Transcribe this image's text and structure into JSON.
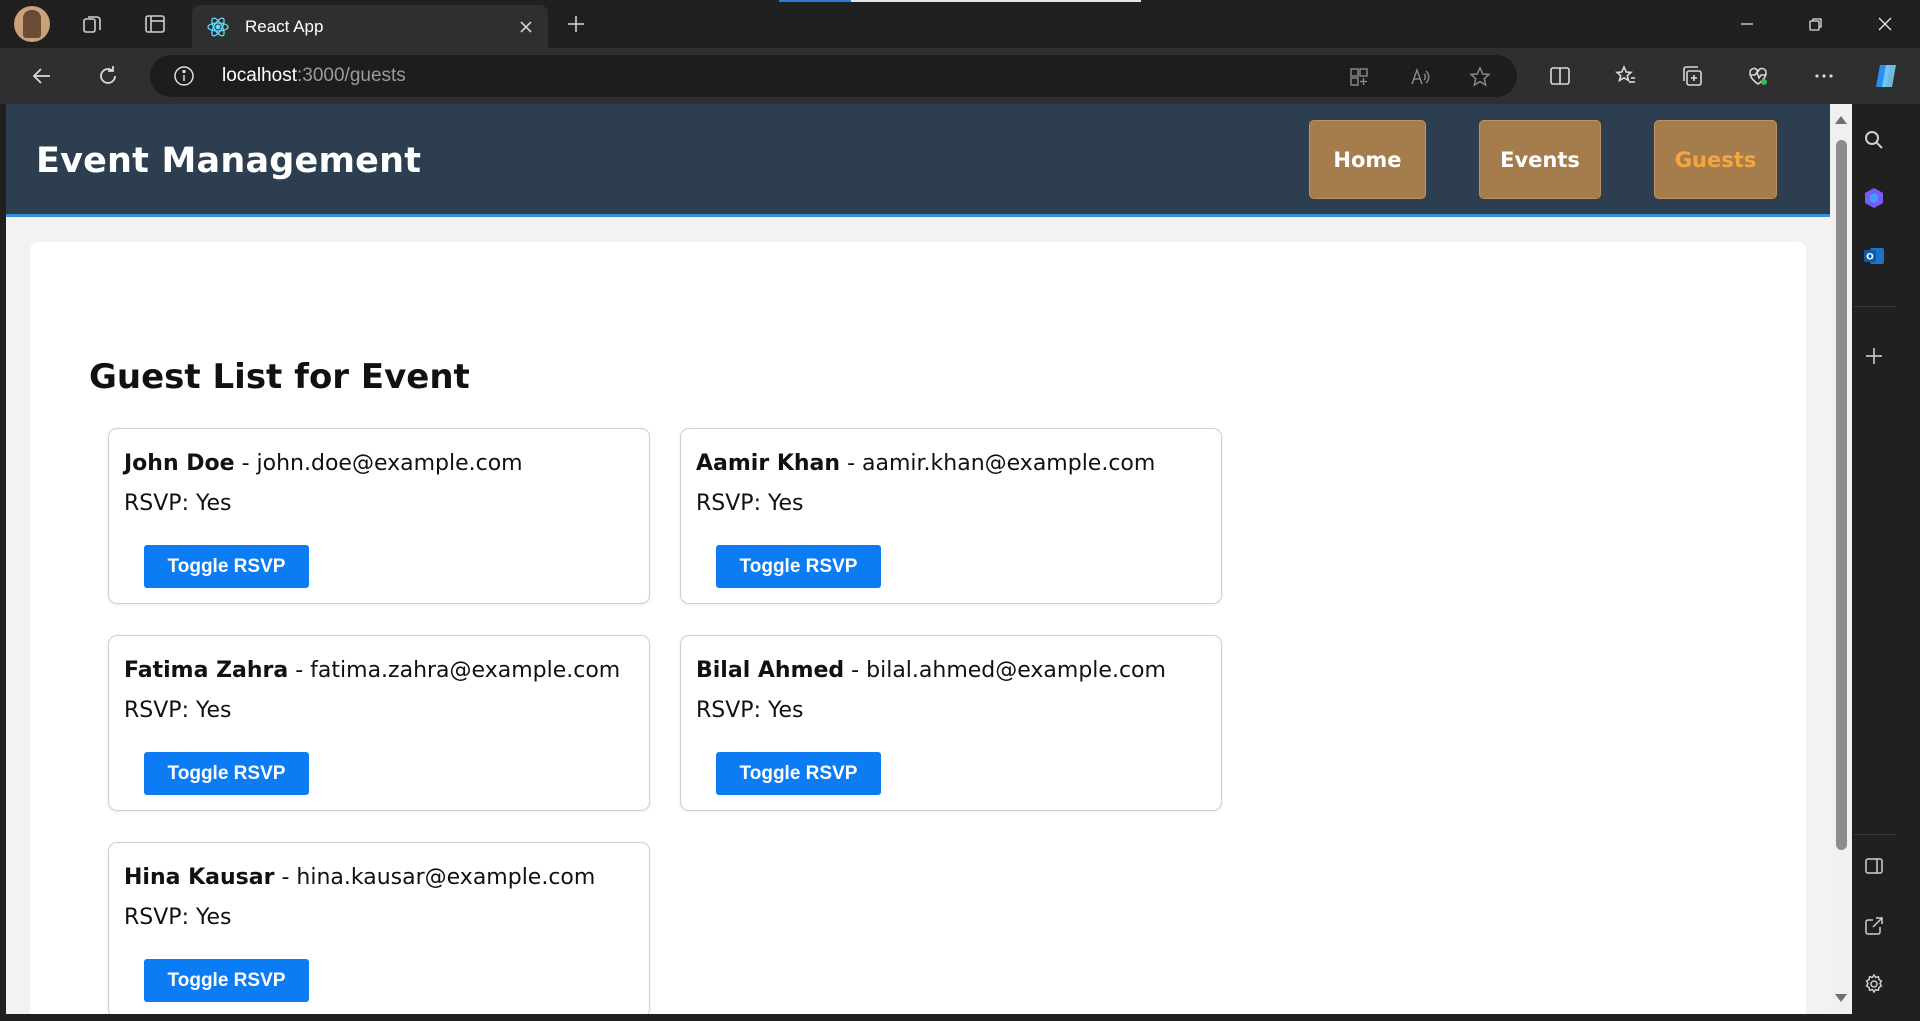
{
  "browser": {
    "tab_title": "React App",
    "url_host": "localhost",
    "url_rest": ":3000/guests"
  },
  "app": {
    "title": "Event Management",
    "nav": [
      {
        "label": "Home",
        "active": false
      },
      {
        "label": "Events",
        "active": false
      },
      {
        "label": "Guests",
        "active": true
      }
    ]
  },
  "guests": {
    "heading": "Guest List for Event",
    "separator": " - ",
    "rsvp_prefix": "RSVP: ",
    "toggle_label": "Toggle RSVP",
    "items": [
      {
        "name": "John Doe",
        "email": "john.doe@example.com",
        "rsvp": "Yes"
      },
      {
        "name": "Aamir Khan",
        "email": "aamir.khan@example.com",
        "rsvp": "Yes"
      },
      {
        "name": "Fatima Zahra",
        "email": "fatima.zahra@example.com",
        "rsvp": "Yes"
      },
      {
        "name": "Bilal Ahmed",
        "email": "bilal.ahmed@example.com",
        "rsvp": "Yes"
      },
      {
        "name": "Hina Kausar",
        "email": "hina.kausar@example.com",
        "rsvp": "Yes"
      }
    ]
  },
  "colors": {
    "header_bg": "#2c3e50",
    "nav_button_bg": "#a57d4d",
    "nav_active_text": "#f6a540",
    "toggle_button_bg": "#0b7cf3"
  }
}
